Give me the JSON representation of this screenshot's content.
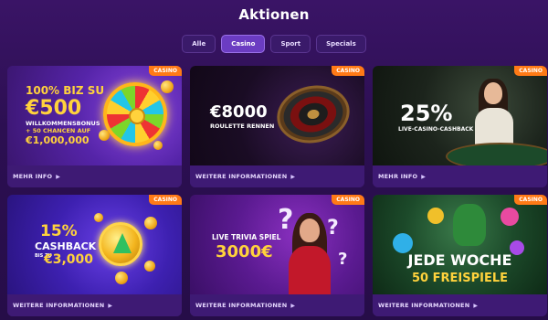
{
  "header": {
    "title": "Aktionen"
  },
  "tabs": [
    {
      "label": "Alle"
    },
    {
      "label": "Casino",
      "active": true
    },
    {
      "label": "Sport"
    },
    {
      "label": "Specials"
    }
  ],
  "cards": [
    {
      "badge": "CASINO",
      "lines": [
        "100% BIZ SU",
        "€500",
        "WILLKOMMENSBONUS",
        "+ 50 CHANCEN AUF",
        "€1,000,000"
      ],
      "link": "MEHR INFO"
    },
    {
      "badge": "CASINO",
      "lines": [
        "€8000",
        "ROULETTE RENNEN"
      ],
      "link": "WEITERE INFORMATIONEN"
    },
    {
      "badge": "CASINO",
      "lines": [
        "25%",
        "LIVE-CASINO-CASHBACK"
      ],
      "link": "MEHR INFO"
    },
    {
      "badge": "CASINO",
      "lines": [
        "15%",
        "CASHBACK",
        "BIS ZU",
        "€3,000"
      ],
      "link": "WEITERE INFORMATIONEN"
    },
    {
      "badge": "CASINO",
      "lines": [
        "LIVE TRIVIA SPIEL",
        "3000€"
      ],
      "link": "WEITERE INFORMATIONEN"
    },
    {
      "badge": "CASINO",
      "lines": [
        "JEDE WOCHE",
        "50 FREISPIELE"
      ],
      "link": "WEITERE INFORMATIONEN"
    }
  ],
  "icons": {
    "link_arrow": "chevron-right-icon"
  },
  "colors": {
    "badge": "#ff7a16",
    "highlight": "#ffd23c",
    "active_tab": "#6b3cc2"
  }
}
